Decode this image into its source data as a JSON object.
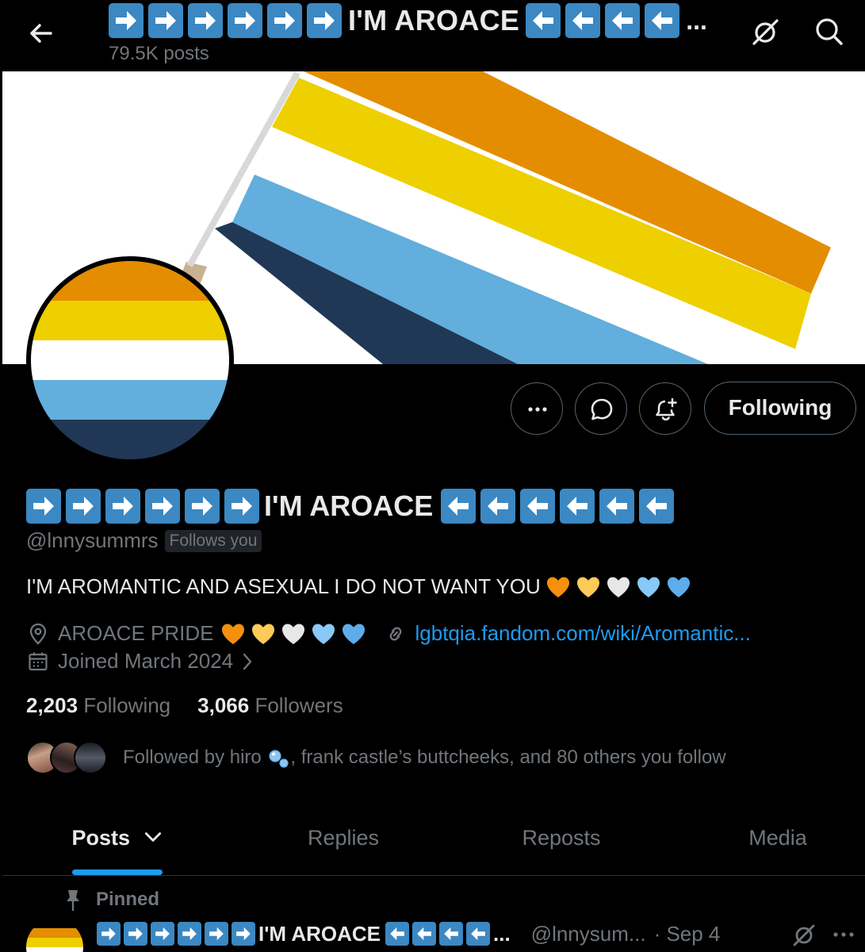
{
  "header": {
    "title_text": "I'M AROACE",
    "title_ellipsis": "...",
    "post_count": "79.5K posts"
  },
  "profile": {
    "display_name": "I'M AROACE",
    "handle": "@lnnysummrs",
    "follows_you": "Follows you",
    "bio": "I'M AROMANTIC AND ASEXUAL I DO NOT WANT YOU",
    "location": "AROACE PRIDE",
    "website": "lgbtqia.fandom.com/wiki/Aromantic...",
    "joined": "Joined March 2024",
    "following_count": "2,203",
    "following_label": "Following",
    "followers_count": "3,066",
    "followers_label": "Followers",
    "followed_by": "Followed by hiro",
    "followed_by_rest": ", frank castle’s buttcheeks, and 80 others you follow"
  },
  "buttons": {
    "following": "Following"
  },
  "tabs": [
    {
      "label": "Posts"
    },
    {
      "label": "Replies"
    },
    {
      "label": "Reposts"
    },
    {
      "label": "Media"
    }
  ],
  "pinned_post": {
    "pinned_label": "Pinned",
    "name": "I'M AROACE",
    "ellipsis": "...",
    "handle": "@lnnysum...",
    "date": "· Sep 4"
  },
  "colors": {
    "aroace_orange": "#e48d00",
    "aroace_yellow": "#eecf00",
    "aroace_white": "#ffffff",
    "aroace_light_blue": "#62aedc",
    "aroace_dark_blue": "#203856",
    "accent": "#1d9bf0",
    "emoji_blue": "#3b88c3"
  },
  "icons": {
    "back": "arrow-left-icon",
    "grok": "grok-icon",
    "search": "search-icon",
    "more": "more-icon",
    "message": "message-icon",
    "notify": "bell-plus-icon",
    "location": "location-pin-icon",
    "link": "link-icon",
    "calendar": "calendar-icon",
    "pin": "pin-icon"
  }
}
